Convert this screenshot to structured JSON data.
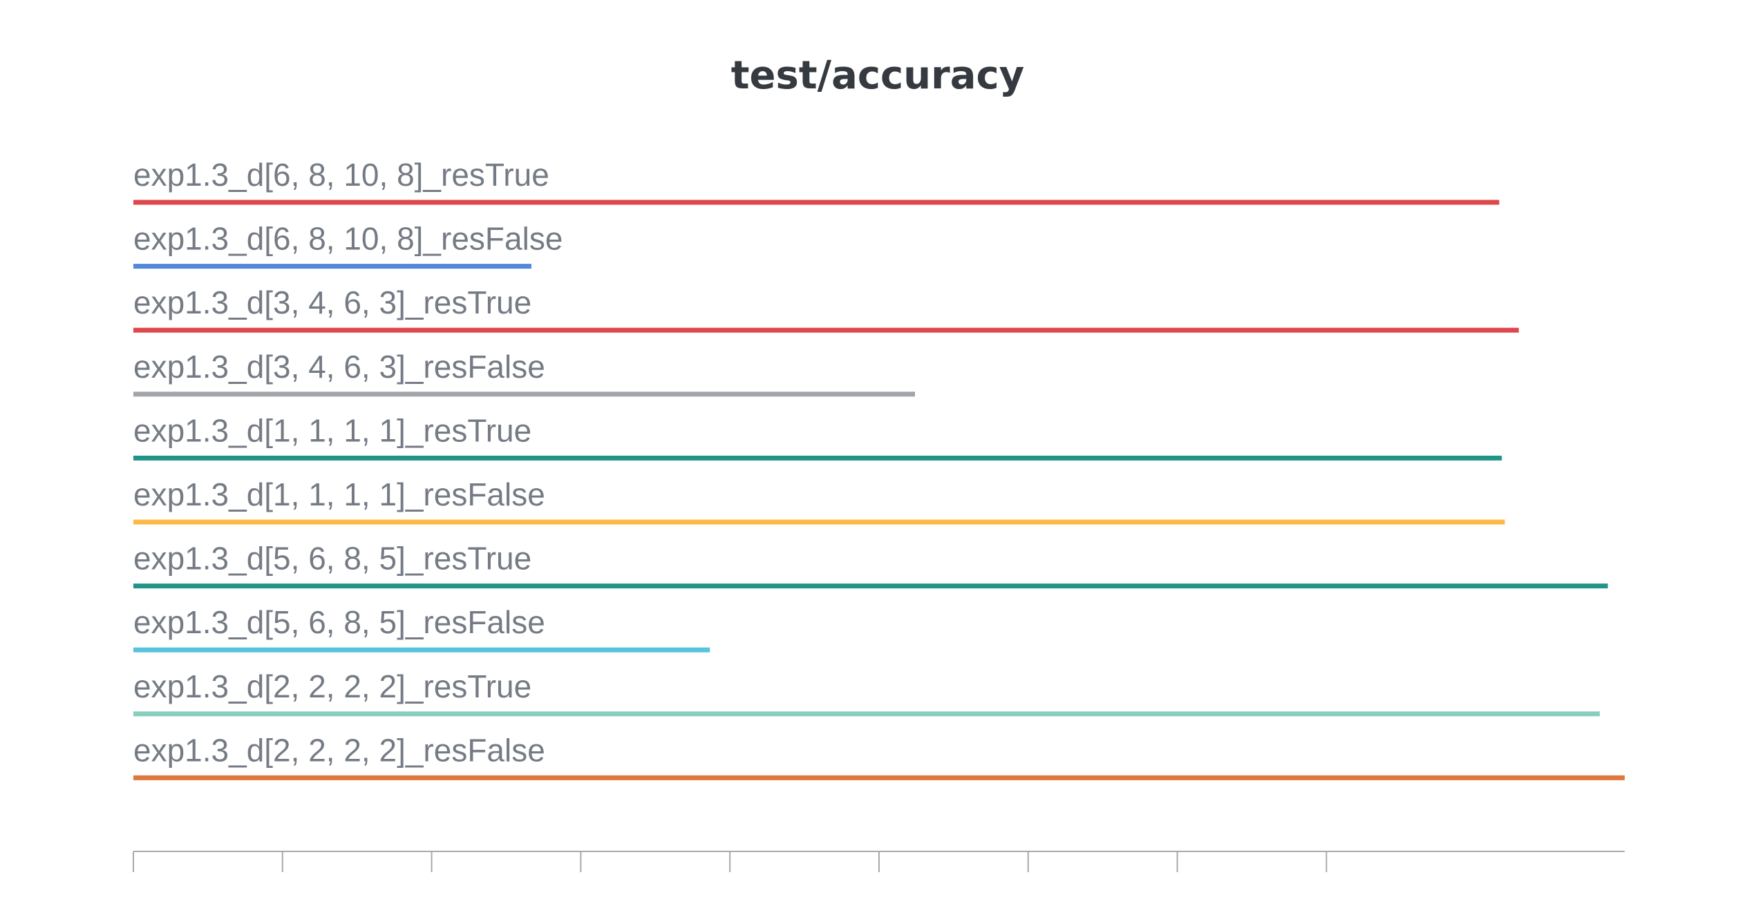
{
  "chart_data": {
    "type": "bar",
    "orientation": "horizontal",
    "title": "test/accuracy",
    "xlabel": "",
    "ylabel": "",
    "xlim": [
      0,
      1.0
    ],
    "x_ticks": [
      0,
      0.1,
      0.2,
      0.3,
      0.4,
      0.5,
      0.6,
      0.7,
      0.8
    ],
    "x_tick_labels_visible": false,
    "grid": false,
    "legend": "none",
    "series": [
      {
        "label": "exp1.3_d[6, 8, 10, 8]_resTrue",
        "value": 0.9159,
        "color": "#e0474c"
      },
      {
        "label": "exp1.3_d[6, 8, 10, 8]_resFalse",
        "value": 0.2669,
        "color": "#5387dd"
      },
      {
        "label": "exp1.3_d[3, 4, 6, 3]_resTrue",
        "value": 0.929,
        "color": "#e0474c"
      },
      {
        "label": "exp1.3_d[3, 4, 6, 3]_resFalse",
        "value": 0.5241,
        "color": "#a1a4a9"
      },
      {
        "label": "exp1.3_d[1, 1, 1, 1]_resTrue",
        "value": 0.9176,
        "color": "#229487"
      },
      {
        "label": "exp1.3_d[1, 1, 1, 1]_resFalse",
        "value": 0.9196,
        "color": "#fbb945"
      },
      {
        "label": "exp1.3_d[5, 6, 8, 5]_resTrue",
        "value": 0.9887,
        "color": "#229487"
      },
      {
        "label": "exp1.3_d[5, 6, 8, 5]_resFalse",
        "value": 0.3866,
        "color": "#58c3dc"
      },
      {
        "label": "exp1.3_d[2, 2, 2, 2]_resTrue",
        "value": 0.9833,
        "color": "#87cebf"
      },
      {
        "label": "exp1.3_d[2, 2, 2, 2]_resFalse",
        "value": 1.0,
        "color": "#e0773c"
      }
    ]
  }
}
